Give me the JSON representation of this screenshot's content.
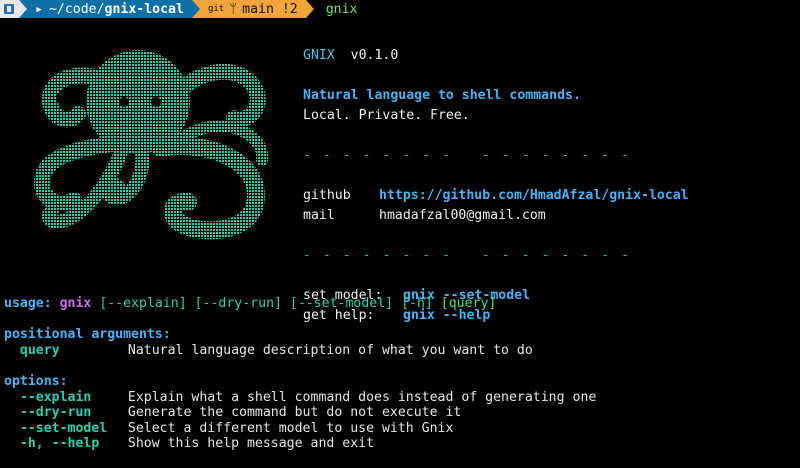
{
  "prompt": {
    "dir_prefix": "~/code/",
    "dir_name": "gnix-local",
    "git_tag": "git",
    "branch": "main !2",
    "command": "gnix",
    "colors": {
      "os": "#e8e8e8",
      "dir": "#0f6fa8",
      "git": "#f0a43a"
    }
  },
  "logo": {
    "icon": "octopus-ascii-art",
    "color": "#2bd0b3"
  },
  "info": {
    "name": "GNIX",
    "version": "v0.1.0",
    "tagline": "Natural language to shell commands.",
    "subtitle": "Local. Private. Free.",
    "divider": "- - - - - - - -   - - - - - - - -",
    "github_label": "github",
    "github_url": "https://github.com/HmadAfzal/gnix-local",
    "mail_label": "mail",
    "mail_value": "hmadafzal00@gmail.com",
    "set_model_label": "set model:",
    "set_model_cmd": "gnix --set-model",
    "get_help_label": "get help:",
    "get_help_cmd": "gnix --help"
  },
  "usage": {
    "label": "usage:",
    "prog": "gnix",
    "opt_explain": "[--explain]",
    "opt_dry_run": "[--dry-run]",
    "opt_set_model": "[--set-model]",
    "opt_h": "[-h]",
    "opt_query": "[query]"
  },
  "positional": {
    "heading": "positional arguments:",
    "args": [
      {
        "name": "query",
        "desc": "Natural language description of what you want to do"
      }
    ]
  },
  "options": {
    "heading": "options:",
    "items": [
      {
        "name": "--explain",
        "desc": "Explain what a shell command does instead of generating one"
      },
      {
        "name": "--dry-run",
        "desc": "Generate the command but do not execute it"
      },
      {
        "name": "--set-model",
        "desc": "Select a different model to use with Gnix"
      },
      {
        "name": "-h, --help",
        "desc": "Show this help message and exit"
      }
    ]
  }
}
